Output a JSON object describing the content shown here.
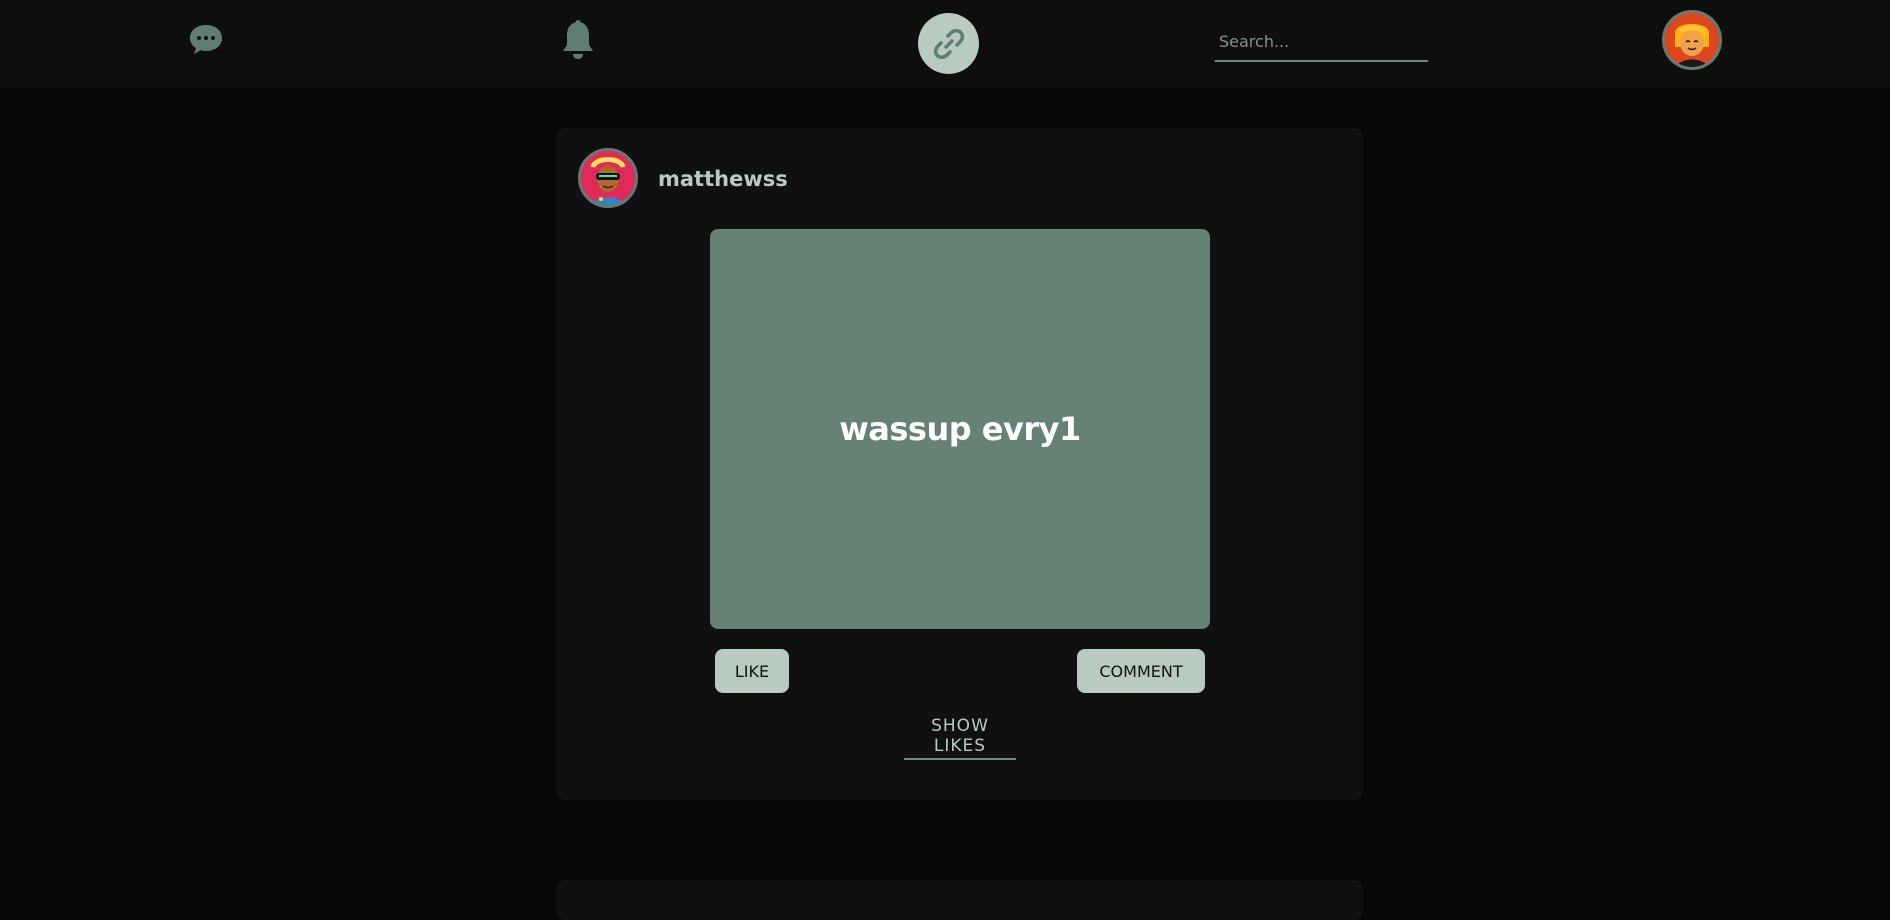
{
  "nav": {
    "messages_icon": "chat-bubble-icon",
    "notifications_icon": "bell-icon",
    "home_icon": "link-icon",
    "search_placeholder": "Search...",
    "accent_color": "#b9cac1",
    "muted_color": "#5f7d72"
  },
  "post": {
    "author": "matthewss",
    "content": "wassup evry1",
    "like_label": "LIKE",
    "comment_label": "COMMENT",
    "show_likes_label": "SHOW LIKES",
    "body_color": "#668275"
  }
}
